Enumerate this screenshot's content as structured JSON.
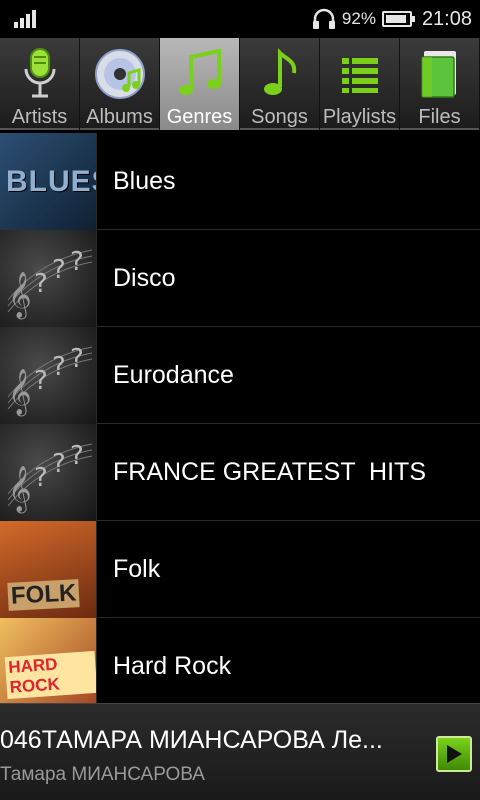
{
  "status_bar": {
    "battery_percent_text": "92%",
    "battery_level": 0.92,
    "time": "21:08",
    "icons": [
      "signal-icon",
      "headphones-icon",
      "battery-icon"
    ]
  },
  "tabs": [
    {
      "label": "Artists",
      "icon": "microphone-icon",
      "active": false
    },
    {
      "label": "Albums",
      "icon": "disc-icon",
      "active": false
    },
    {
      "label": "Genres",
      "icon": "music-notes-icon",
      "active": true
    },
    {
      "label": "Songs",
      "icon": "music-note-icon",
      "active": false
    },
    {
      "label": "Playlists",
      "icon": "list-icon",
      "active": false
    },
    {
      "label": "Files",
      "icon": "folder-icon",
      "active": false
    }
  ],
  "genres": [
    {
      "label": "Blues",
      "thumb_text": "BLUES"
    },
    {
      "label": "Disco"
    },
    {
      "label": "Eurodance"
    },
    {
      "label": "FRANCE GREATEST  HITS"
    },
    {
      "label": "Folk",
      "thumb_text": "FOLK"
    },
    {
      "label": "Hard Rock",
      "thumb_text": "HARD ROCK"
    }
  ],
  "now_playing": {
    "title": "046ТАМАРА МИАНСАРОВА Ле...",
    "artist": "Тамара МИАНСАРОВА"
  },
  "colors": {
    "accent_green": "#7bd11a",
    "background": "#000000"
  }
}
